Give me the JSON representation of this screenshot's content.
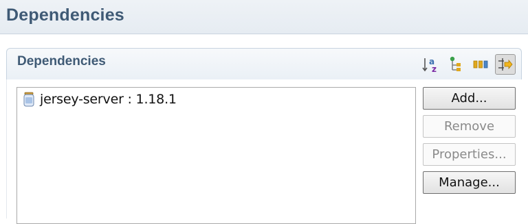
{
  "page": {
    "title": "Dependencies"
  },
  "section": {
    "title": "Dependencies",
    "toolbar": [
      {
        "icon": "sort-alpha-icon",
        "pressed": false
      },
      {
        "icon": "tree-hierarchy-icon",
        "pressed": false
      },
      {
        "icon": "columns-icon",
        "pressed": false
      },
      {
        "icon": "filter-arrows-icon",
        "pressed": true
      }
    ]
  },
  "dependencies": [
    {
      "label": "jersey-server : 1.18.1",
      "icon": "jar-icon"
    }
  ],
  "buttons": {
    "add": "Add...",
    "remove": "Remove",
    "properties": "Properties...",
    "manage": "Manage..."
  },
  "colors": {
    "title": "#3f5a75",
    "header_bg": "#eaf0f6",
    "border": "#c6d3e0"
  }
}
